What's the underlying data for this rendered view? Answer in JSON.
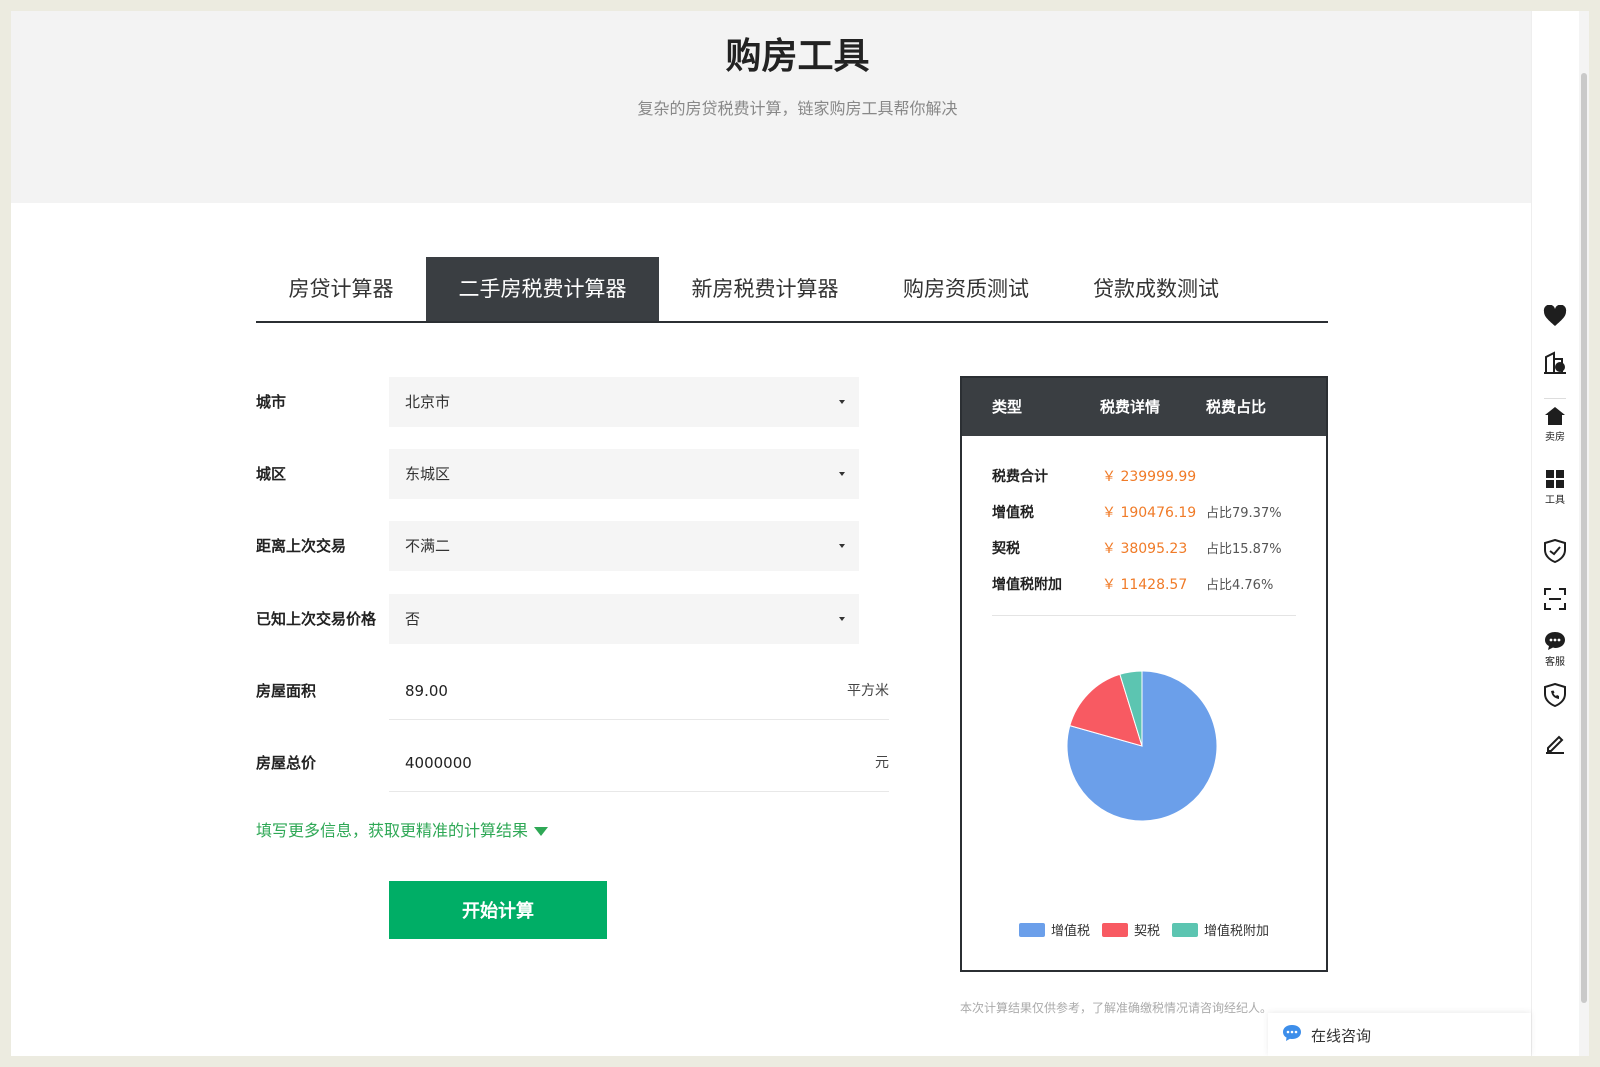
{
  "hero": {
    "title": "购房工具",
    "subtitle": "复杂的房贷税费计算，链家购房工具帮你解决"
  },
  "tabs": [
    {
      "label": "房贷计算器",
      "active": false
    },
    {
      "label": "二手房税费计算器",
      "active": true
    },
    {
      "label": "新房税费计算器",
      "active": false
    },
    {
      "label": "购房资质测试",
      "active": false
    },
    {
      "label": "贷款成数测试",
      "active": false
    }
  ],
  "form": {
    "city": {
      "label": "城市",
      "value": "北京市"
    },
    "district": {
      "label": "城区",
      "value": "东城区"
    },
    "last_trade": {
      "label": "距离上次交易",
      "value": "不满二"
    },
    "known_price": {
      "label": "已知上次交易价格",
      "value": "否"
    },
    "area": {
      "label": "房屋面积",
      "value": "89.00",
      "unit": "平方米"
    },
    "total_price": {
      "label": "房屋总价",
      "value": "4000000",
      "unit": "元"
    },
    "more_link": "填写更多信息，获取更精准的计算结果",
    "submit_label": "开始计算"
  },
  "result": {
    "headers": [
      "类型",
      "税费详情",
      "税费占比"
    ],
    "rows": [
      {
        "type": "税费合计",
        "amount": "￥ 239999.99",
        "ratio": ""
      },
      {
        "type": "增值税",
        "amount": "￥ 190476.19",
        "ratio": "占比79.37%"
      },
      {
        "type": "契税",
        "amount": "￥ 38095.23",
        "ratio": "占比15.87%"
      },
      {
        "type": "增值税附加",
        "amount": "￥ 11428.57",
        "ratio": "占比4.76%"
      }
    ],
    "legend": [
      {
        "name": "增值税",
        "color": "#6b9fea"
      },
      {
        "name": "契税",
        "color": "#f85a62"
      },
      {
        "name": "增值税附加",
        "color": "#5cc5b1"
      }
    ],
    "pie_values": [
      79.37,
      15.87,
      4.76
    ],
    "disclaimer": "本次计算结果仅供参考，了解准确缴税情况请咨询经纪人。"
  },
  "sidebar": {
    "items": [
      {
        "icon": "heart-icon",
        "label": ""
      },
      {
        "icon": "compare-icon",
        "label": ""
      },
      {
        "icon": "home-icon",
        "label": "卖房"
      },
      {
        "icon": "calculator-icon",
        "label": "工具"
      },
      {
        "icon": "shield-icon",
        "label": ""
      },
      {
        "icon": "scan-icon",
        "label": ""
      },
      {
        "icon": "chat-bubble-icon",
        "label": "客服"
      },
      {
        "icon": "phone-icon",
        "label": ""
      },
      {
        "icon": "edit-icon",
        "label": ""
      }
    ]
  },
  "chat": {
    "label": "在线咨询",
    "icon": "chat-icon"
  }
}
